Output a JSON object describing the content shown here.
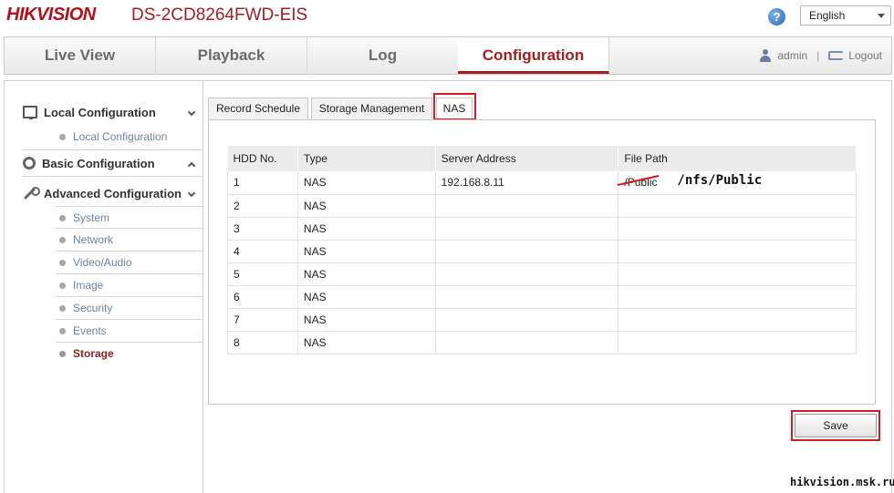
{
  "header": {
    "logo": "HIKVISION",
    "model": "DS-2CD8264FWD-EIS",
    "help_glyph": "?",
    "language": "English"
  },
  "nav": {
    "tabs": [
      {
        "label": "Live View"
      },
      {
        "label": "Playback"
      },
      {
        "label": "Log"
      },
      {
        "label": "Configuration"
      }
    ],
    "active_tab": "Configuration",
    "user": "admin",
    "separator": "|",
    "logout": "Logout"
  },
  "sidebar": {
    "local_config": {
      "label": "Local Configuration",
      "items": [
        "Local Configuration"
      ]
    },
    "basic_config": {
      "label": "Basic Configuration"
    },
    "advanced_config": {
      "label": "Advanced Configuration",
      "items": [
        "System",
        "Network",
        "Video/Audio",
        "Image",
        "Security",
        "Events",
        "Storage"
      ]
    },
    "active_item": "Storage"
  },
  "subtabs": [
    "Record Schedule",
    "Storage Management",
    "NAS"
  ],
  "active_subtab": "NAS",
  "table": {
    "headers": [
      "HDD No.",
      "Type",
      "Server Address",
      "File Path"
    ],
    "rows": [
      [
        "1",
        "NAS",
        "192.168.8.11",
        "/Public"
      ],
      [
        "2",
        "NAS",
        "",
        ""
      ],
      [
        "3",
        "NAS",
        "",
        ""
      ],
      [
        "4",
        "NAS",
        "",
        ""
      ],
      [
        "5",
        "NAS",
        "",
        ""
      ],
      [
        "6",
        "NAS",
        "",
        ""
      ],
      [
        "7",
        "NAS",
        "",
        ""
      ],
      [
        "8",
        "NAS",
        "",
        ""
      ]
    ]
  },
  "annotation": {
    "corrected_path": "/nfs/Public",
    "highlight_color": "#d11e24"
  },
  "save_label": "Save",
  "watermark": "hikvision.msk.ru",
  "colors": {
    "brand": "#b3121d",
    "accent": "#a21f24",
    "link": "#6f85a3"
  }
}
